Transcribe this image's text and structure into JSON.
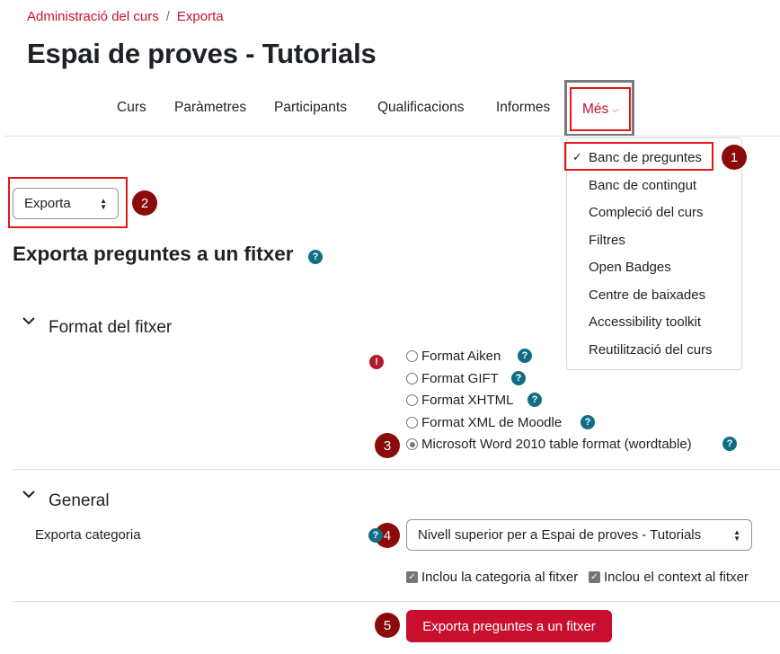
{
  "breadcrumb": [
    "Administració del curs",
    "Exporta"
  ],
  "breadcrumb_separator": "/",
  "page_title": "Espai de proves - Tutorials",
  "nav": {
    "items": [
      "Curs",
      "Paràmetres",
      "Participants",
      "Qualificacions",
      "Informes"
    ],
    "more_label": "Més"
  },
  "dropdown": {
    "items": [
      "Banc de preguntes",
      "Banc de contingut",
      "Compleció del curs",
      "Filtres",
      "Open Badges",
      "Centre de baixades",
      "Accessibility toolkit",
      "Reutilització del curs"
    ],
    "checked_index": 0
  },
  "badges": [
    "1",
    "2",
    "3",
    "4",
    "5"
  ],
  "page_select": {
    "value": "Exporta"
  },
  "section_title": "Exporta preguntes a un fitxer",
  "format_section": {
    "title": "Format del fitxer",
    "options": [
      "Format Aiken",
      "Format GIFT",
      "Format XHTML",
      "Format XML de Moodle",
      "Microsoft Word 2010 table format (wordtable)"
    ],
    "selected_index": 4
  },
  "general_section": {
    "title": "General",
    "category_label": "Exporta categoria",
    "category_value": "Nivell superior per a Espai de proves - Tutorials",
    "checkbox_category": "Inclou la categoria al fitxer",
    "checkbox_context": "Inclou el context al fitxer"
  },
  "submit_label": "Exporta preguntes a un fitxer",
  "icons": {
    "help": "?",
    "error": "!",
    "chevron": "chevron-down-icon",
    "check": "✓"
  },
  "colors": {
    "accent": "#c8102e",
    "badge": "#8b0a0a",
    "help": "#0f6e85",
    "highlight": "#e5161b"
  }
}
